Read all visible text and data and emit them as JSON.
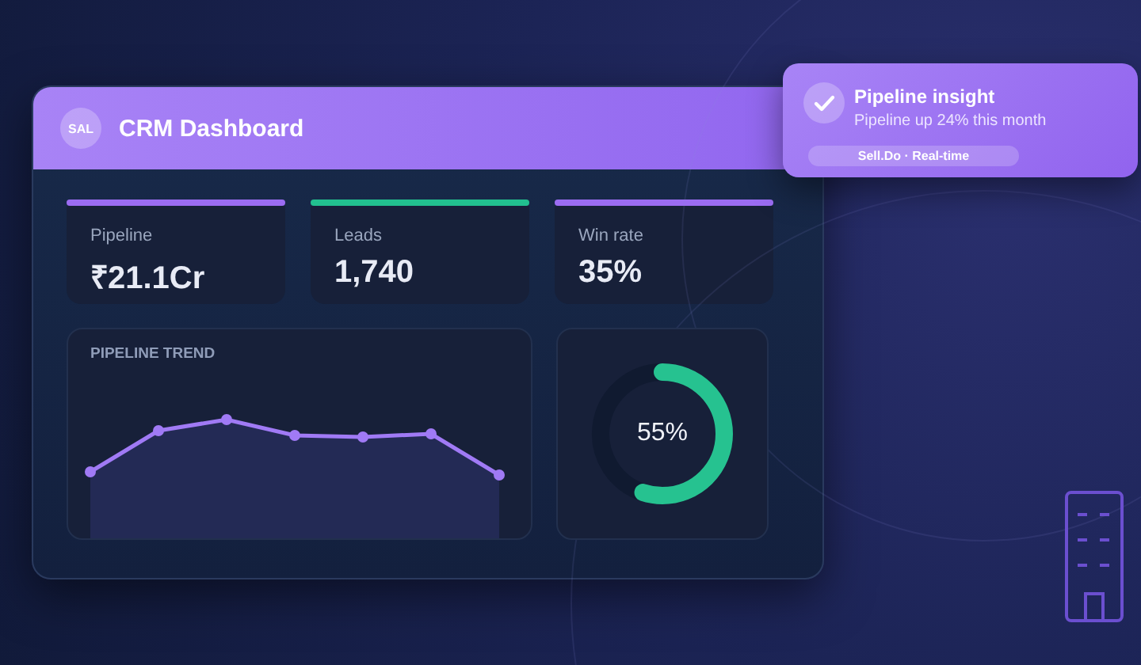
{
  "dashboard": {
    "avatar": "SAL",
    "title": "CRM Dashboard",
    "stats": [
      {
        "label": "Pipeline",
        "value": "₹21.1Cr",
        "color": "#9b6cf2"
      },
      {
        "label": "Leads",
        "value": "1,740",
        "color": "#22c08f"
      },
      {
        "label": "Win rate",
        "value": "35%",
        "color": "#9b6cf2"
      }
    ],
    "trend": {
      "title": "PIPELINE TREND"
    },
    "donut": {
      "level": 0.55,
      "reading": "55%"
    }
  },
  "toast": {
    "title": "Pipeline insight",
    "message": "Pipeline up 24% this month",
    "tag": "Sell.Do · Real-time"
  }
}
